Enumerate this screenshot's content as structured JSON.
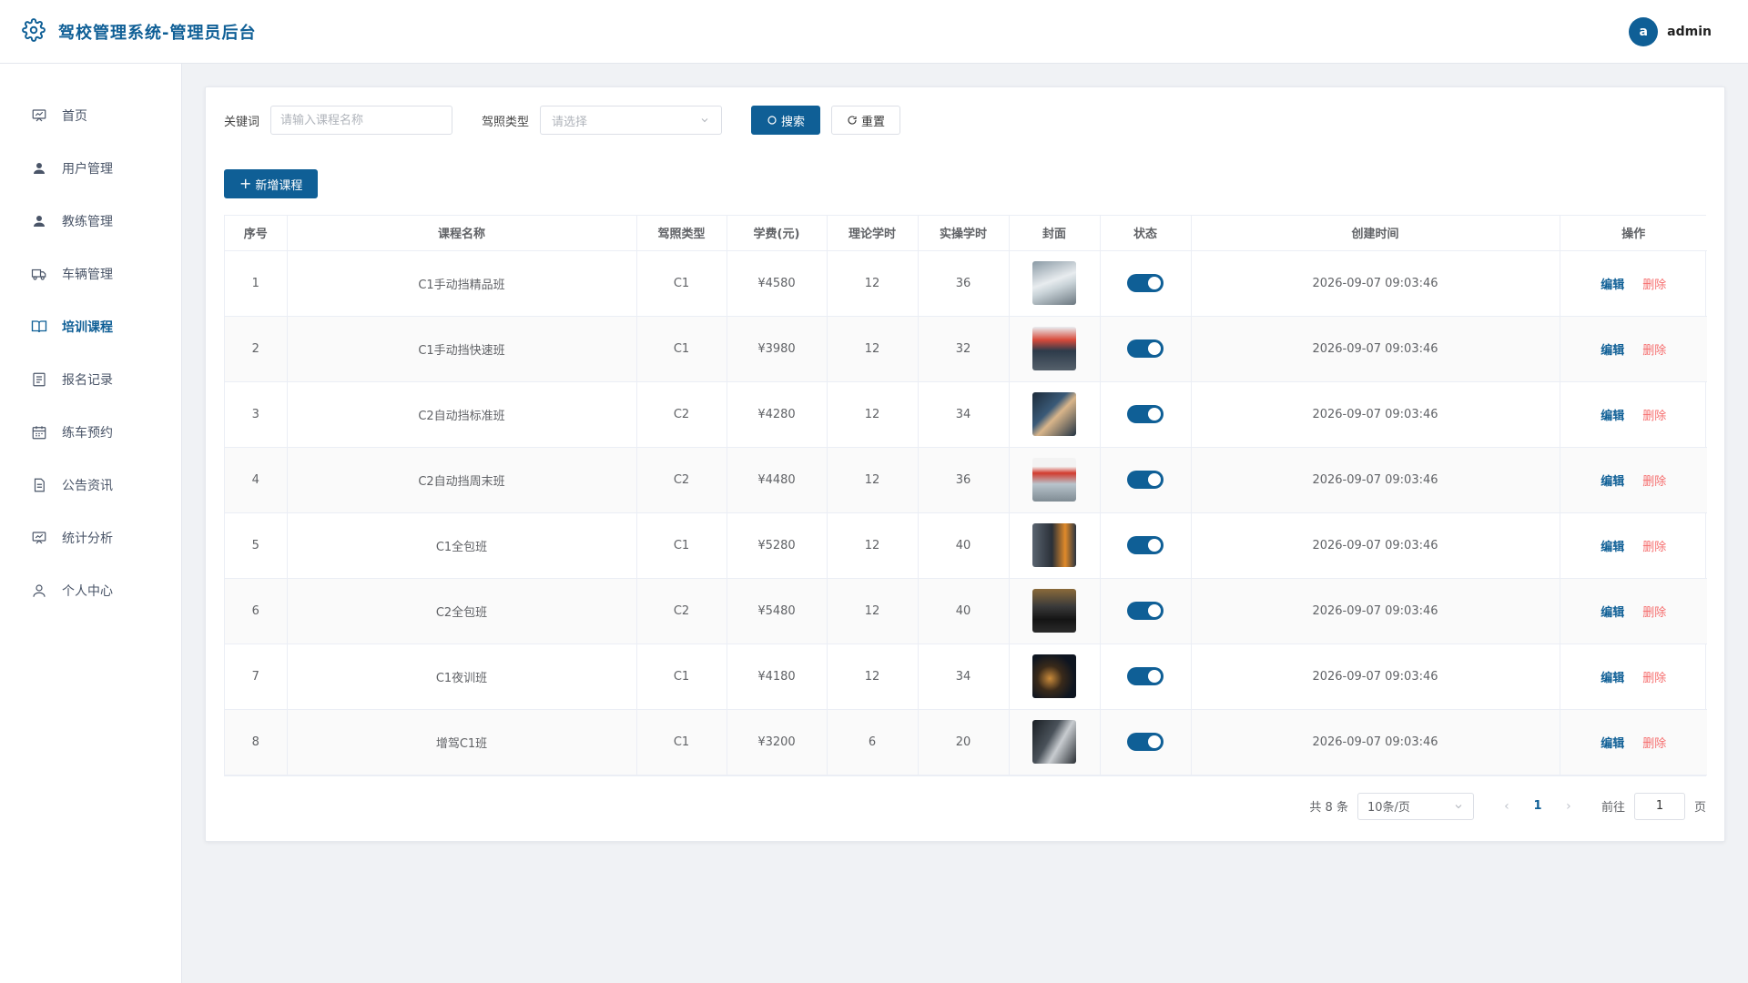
{
  "header": {
    "title": "驾校管理系统-管理员后台",
    "avatar_letter": "a",
    "username": "admin"
  },
  "sidebar": {
    "items": [
      {
        "label": "首页",
        "icon": "presentation-icon",
        "active": false
      },
      {
        "label": "用户管理",
        "icon": "user-icon",
        "active": false
      },
      {
        "label": "教练管理",
        "icon": "user-icon",
        "active": false
      },
      {
        "label": "车辆管理",
        "icon": "truck-icon",
        "active": false
      },
      {
        "label": "培训课程",
        "icon": "book-icon",
        "active": true
      },
      {
        "label": "报名记录",
        "icon": "document-icon",
        "active": false
      },
      {
        "label": "练车预约",
        "icon": "calendar-icon",
        "active": false
      },
      {
        "label": "公告资讯",
        "icon": "notice-icon",
        "active": false
      },
      {
        "label": "统计分析",
        "icon": "presentation-icon",
        "active": false
      },
      {
        "label": "个人中心",
        "icon": "user-outline-icon",
        "active": false
      }
    ]
  },
  "filters": {
    "keyword_label": "关键词",
    "keyword_placeholder": "请输入课程名称",
    "license_label": "驾照类型",
    "license_placeholder": "请选择",
    "search_label": "搜索",
    "reset_label": "重置"
  },
  "add_button": "新增课程",
  "table": {
    "headers": [
      "序号",
      "课程名称",
      "驾照类型",
      "学费(元)",
      "理论学时",
      "实操学时",
      "封面",
      "状态",
      "创建时间",
      "操作"
    ],
    "rows": [
      {
        "no": "1",
        "name": "C1手动挡精品班",
        "license": "C1",
        "fee": "¥4580",
        "theory": "12",
        "practice": "36",
        "created": "2026-09-07 09:03:46",
        "enabled": true
      },
      {
        "no": "2",
        "name": "C1手动挡快速班",
        "license": "C1",
        "fee": "¥3980",
        "theory": "12",
        "practice": "32",
        "created": "2026-09-07 09:03:46",
        "enabled": true
      },
      {
        "no": "3",
        "name": "C2自动挡标准班",
        "license": "C2",
        "fee": "¥4280",
        "theory": "12",
        "practice": "34",
        "created": "2026-09-07 09:03:46",
        "enabled": true
      },
      {
        "no": "4",
        "name": "C2自动挡周末班",
        "license": "C2",
        "fee": "¥4480",
        "theory": "12",
        "practice": "36",
        "created": "2026-09-07 09:03:46",
        "enabled": true
      },
      {
        "no": "5",
        "name": "C1全包班",
        "license": "C1",
        "fee": "¥5280",
        "theory": "12",
        "practice": "40",
        "created": "2026-09-07 09:03:46",
        "enabled": true
      },
      {
        "no": "6",
        "name": "C2全包班",
        "license": "C2",
        "fee": "¥5480",
        "theory": "12",
        "practice": "40",
        "created": "2026-09-07 09:03:46",
        "enabled": true
      },
      {
        "no": "7",
        "name": "C1夜训班",
        "license": "C1",
        "fee": "¥4180",
        "theory": "12",
        "practice": "34",
        "created": "2026-09-07 09:03:46",
        "enabled": true
      },
      {
        "no": "8",
        "name": "增驾C1班",
        "license": "C1",
        "fee": "¥3200",
        "theory": "6",
        "practice": "20",
        "created": "2026-09-07 09:03:46",
        "enabled": true
      }
    ],
    "edit_label": "编辑",
    "delete_label": "删除"
  },
  "pagination": {
    "total_text": "共 8 条",
    "page_size": "10条/页",
    "current_page": "1",
    "goto_label": "前往",
    "goto_value": "1",
    "page_suffix": "页"
  },
  "colors": {
    "primary": "#0f5f96",
    "danger": "#f56c6c"
  }
}
